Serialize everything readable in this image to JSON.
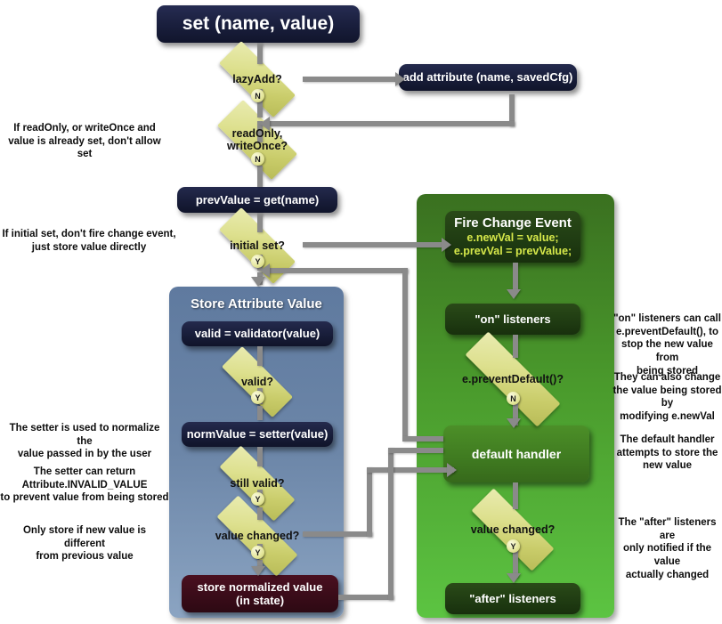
{
  "diagram": {
    "title": "set (name, value)",
    "panels": {
      "store": {
        "title": "Store Attribute Value"
      },
      "event": {
        "title": ""
      }
    },
    "nodes": {
      "set": "set (name, value)",
      "add_attribute": "add attribute (name, savedCfg)",
      "prev_value": "prevValue = get(name)",
      "fire_change_event": "Fire Change Event",
      "fire_line1": "e.newVal = value;",
      "fire_line2": "e.prevVal = prevValue;",
      "on_listeners": "\"on\" listeners",
      "default_handler": "default handler",
      "after_listeners": "\"after\" listeners",
      "validator": "valid = validator(value)",
      "norm_value": "normValue = setter(value)",
      "store_line1": "store normalized value",
      "store_line2": "(in state)"
    },
    "decisions": {
      "lazy_add": "lazyAdd?",
      "read_only_l1": "readOnly,",
      "read_only_l2": "writeOnce?",
      "initial_set": "initial set?",
      "prevent_default": "e.preventDefault()?",
      "valid": "valid?",
      "still_valid": "still valid?",
      "value_changed_blue": "value changed?",
      "value_changed_green": "value changed?"
    },
    "branch_labels": {
      "lazy_add_n": "N",
      "read_only_n": "N",
      "initial_set_y": "Y",
      "prevent_default_n": "N",
      "valid_y": "Y",
      "still_valid_y": "Y",
      "value_changed_blue_y": "Y",
      "value_changed_green_y": "Y"
    },
    "notes": {
      "left_readonly": "If readOnly, or writeOnce and\nvalue is already set, don't allow set",
      "left_initial": "If initial set, don't fire change event,\njust store value directly",
      "left_setter": "The setter is used to normalize the\nvalue passed in by the user",
      "left_invalid": "The setter can return\nAttribute.INVALID_VALUE\nto prevent value from being stored",
      "left_only_store": "Only store if new value is different\nfrom previous value",
      "right_on": "\"on\" listeners can call\ne.preventDefault(), to\nstop the new value from\nbeing stored",
      "right_change": "They can also change\nthe value being stored by\nmodifying e.newVal",
      "right_default": "The default handler\nattempts to store the\nnew value",
      "right_after": "The \"after\" listeners are\nonly notified if the value\nactually changed"
    },
    "colors": {
      "panel_blue": "#6c86a8",
      "panel_green": "#4a9a2c",
      "node_navy": "#191e3c",
      "node_dark_green": "#1f3b12",
      "node_mid_green": "#3f7a20",
      "node_dark_red": "#3a0c19",
      "diamond": "#dde08e",
      "connector": "#8a8a8a",
      "event_text": "#d6e84a"
    }
  }
}
